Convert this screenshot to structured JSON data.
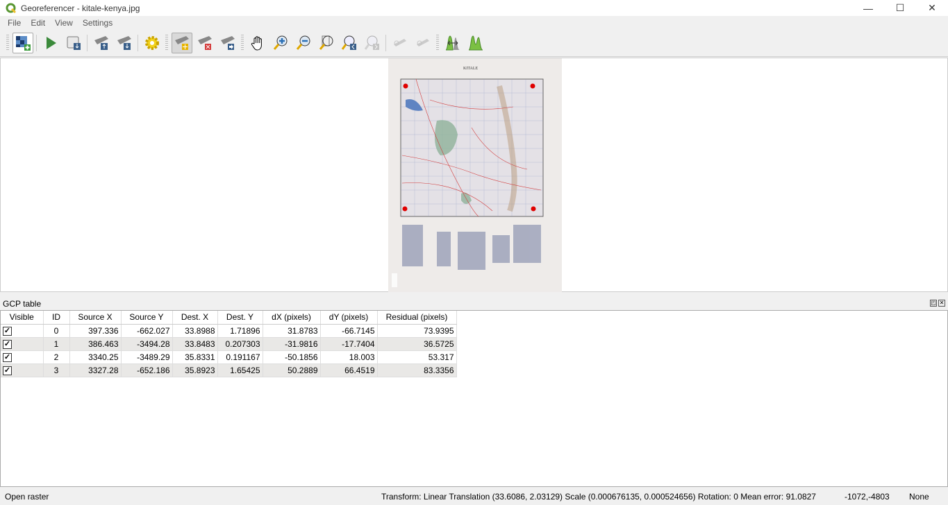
{
  "window": {
    "title": "Georeferencer - kitale-kenya.jpg",
    "minimize": "—",
    "maximize": "☐",
    "close": "✕"
  },
  "menu": [
    "File",
    "Edit",
    "View",
    "Settings"
  ],
  "toolbar": {
    "tools": [
      "open-raster",
      "start-georeferencing",
      "generate-gdal-script",
      "load-gcp-points",
      "save-gcp-points",
      "transformation-settings",
      "add-point",
      "delete-point",
      "move-gcp-point",
      "pan",
      "zoom-in",
      "zoom-out",
      "zoom-to-layer",
      "zoom-last",
      "zoom-next",
      "link-georeferencer-to-qgis",
      "link-qgis-to-georeferencer",
      "full-histogram-stretch",
      "local-histogram-stretch"
    ],
    "active": "add-point"
  },
  "map": {
    "title": "KITALE",
    "gcp_color": "#e00000"
  },
  "gcp_panel": {
    "title": "GCP table",
    "float": "◰",
    "close": "✕"
  },
  "gcp_table": {
    "columns": [
      "Visible",
      "ID",
      "Source X",
      "Source Y",
      "Dest. X",
      "Dest. Y",
      "dX (pixels)",
      "dY (pixels)",
      "Residual (pixels)"
    ],
    "rows": [
      {
        "visible": true,
        "check": "✓",
        "id": "0",
        "src_x": "397.336",
        "src_y": "-662.027",
        "dst_x": "33.8988",
        "dst_y": "1.71896",
        "dx": "31.8783",
        "dy": "-66.7145",
        "residual": "73.9395"
      },
      {
        "visible": true,
        "check": "✓",
        "id": "1",
        "src_x": "386.463",
        "src_y": "-3494.28",
        "dst_x": "33.8483",
        "dst_y": "0.207303",
        "dx": "-31.9816",
        "dy": "-17.7404",
        "residual": "36.5725"
      },
      {
        "visible": true,
        "check": "✓",
        "id": "2",
        "src_x": "3340.25",
        "src_y": "-3489.29",
        "dst_x": "35.8331",
        "dst_y": "0.191167",
        "dx": "-50.1856",
        "dy": "18.003",
        "residual": "53.317"
      },
      {
        "visible": true,
        "check": "✓",
        "id": "3",
        "src_x": "3327.28",
        "src_y": "-652.186",
        "dst_x": "35.8923",
        "dst_y": "1.65425",
        "dx": "50.2889",
        "dy": "66.4519",
        "residual": "83.3356"
      }
    ]
  },
  "status": {
    "message": "Open raster",
    "transform": "Transform: Linear Translation (33.6086, 2.03129) Scale (0.000676135, 0.000524656) Rotation: 0 Mean error: 91.0827",
    "coords": "-1072,-4803",
    "crs": "None"
  }
}
